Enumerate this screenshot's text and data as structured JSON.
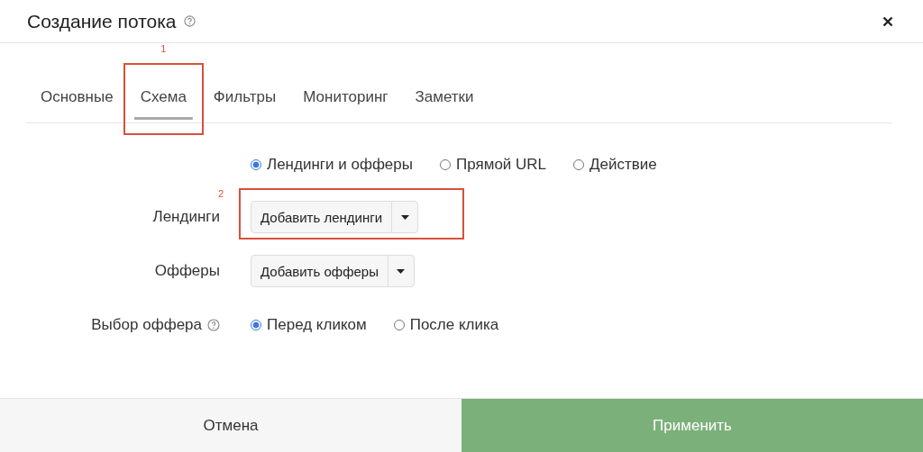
{
  "window": {
    "title": "Создание потока"
  },
  "tabs": [
    {
      "label": "Основные",
      "selected": false
    },
    {
      "label": "Схема",
      "selected": true,
      "callout": "1"
    },
    {
      "label": "Фильтры",
      "selected": false
    },
    {
      "label": "Мониторинг",
      "selected": false
    },
    {
      "label": "Заметки",
      "selected": false
    }
  ],
  "scheme_options": [
    {
      "label": "Лендинги и офферы",
      "selected": true
    },
    {
      "label": "Прямой URL",
      "selected": false
    },
    {
      "label": "Действие",
      "selected": false
    }
  ],
  "fields": [
    {
      "label": "Лендинги",
      "button": "Добавить лендинги",
      "callout": "2"
    },
    {
      "label": "Офферы",
      "button": "Добавить офферы"
    }
  ],
  "offer_choice": {
    "label": "Выбор оффера",
    "options": [
      {
        "label": "Перед кликом",
        "selected": true
      },
      {
        "label": "После клика",
        "selected": false
      }
    ]
  },
  "footer": {
    "cancel": "Отмена",
    "apply": "Применить"
  }
}
